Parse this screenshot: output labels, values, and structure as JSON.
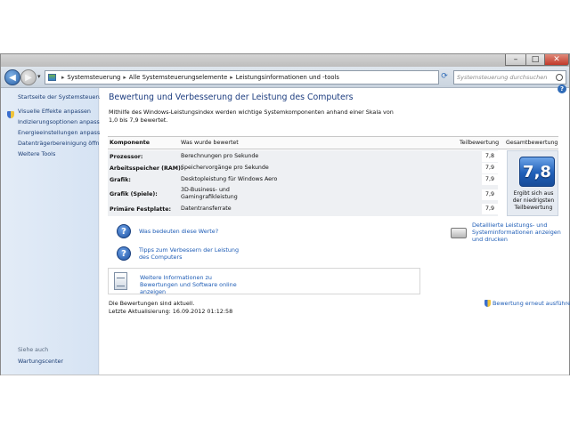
{
  "window": {
    "controls": {
      "minimize": "–",
      "maximize": "□",
      "close": "✕"
    }
  },
  "address": {
    "crumbs": [
      "Systemsteuerung",
      "Alle Systemsteuerungselemente",
      "Leistungsinformationen und -tools"
    ],
    "separator": "▸",
    "search_placeholder": "Systemsteuerung durchsuchen",
    "icons": {
      "back": "arrow-left-icon",
      "forward": "arrow-right-icon",
      "refresh": "refresh-icon",
      "search": "search-icon"
    }
  },
  "sidebar": {
    "home": "Startseite der Systemsteuerung",
    "items": [
      "Visuelle Effekte anpassen",
      "Indizierungsoptionen anpassen",
      "Energieeinstellungen anpassen",
      "Datenträgerbereinigung öffnen",
      "Weitere Tools"
    ],
    "see_also": "Siehe auch",
    "maintenance": "Wartungscenter"
  },
  "main": {
    "title": "Bewertung und Verbesserung der Leistung des Computers",
    "intro": "Mithilfe des Windows-Leistungsindex werden wichtige Systemkomponenten anhand einer Skala von 1,0 bis 7,9 bewertet.",
    "table": {
      "headers": {
        "component": "Komponente",
        "rated": "Was wurde bewertet",
        "subscore": "Teilbewertung",
        "overall": "Gesamtbewertung"
      },
      "rows": [
        {
          "component": "Prozessor:",
          "rated": "Berechnungen pro Sekunde",
          "score": "7,8"
        },
        {
          "component": "Arbeitsspeicher (RAM):",
          "rated": "Speichervorgänge pro Sekunde",
          "score": "7,9"
        },
        {
          "component": "Grafik:",
          "rated": "Desktopleistung für Windows Aero",
          "score": "7,9"
        },
        {
          "component": "Grafik (Spiele):",
          "rated": "3D-Business- und Gamingrafikleistung",
          "score": "7,9"
        },
        {
          "component": "Primäre Festplatte:",
          "rated": "Datentransferrate",
          "score": "7,9"
        }
      ],
      "overall_score": "7,8",
      "overall_note": "Ergibt sich aus der niedrigsten Teilbewertung"
    },
    "links": {
      "meaning": "Was bedeuten diese Werte?",
      "tips": "Tipps zum Verbessern der Leistung des Computers",
      "detailed": "Detaillierte Leistungs- und Systeminformationen anzeigen und drucken",
      "online": "Weitere Informationen zu Bewertungen und Software online anzeigen"
    },
    "status": {
      "current": "Die Bewertungen sind aktuell.",
      "last_update": "Letzte Aktualisierung: 16.09.2012 01:12:58"
    },
    "rerun": "Bewertung erneut ausführen"
  }
}
